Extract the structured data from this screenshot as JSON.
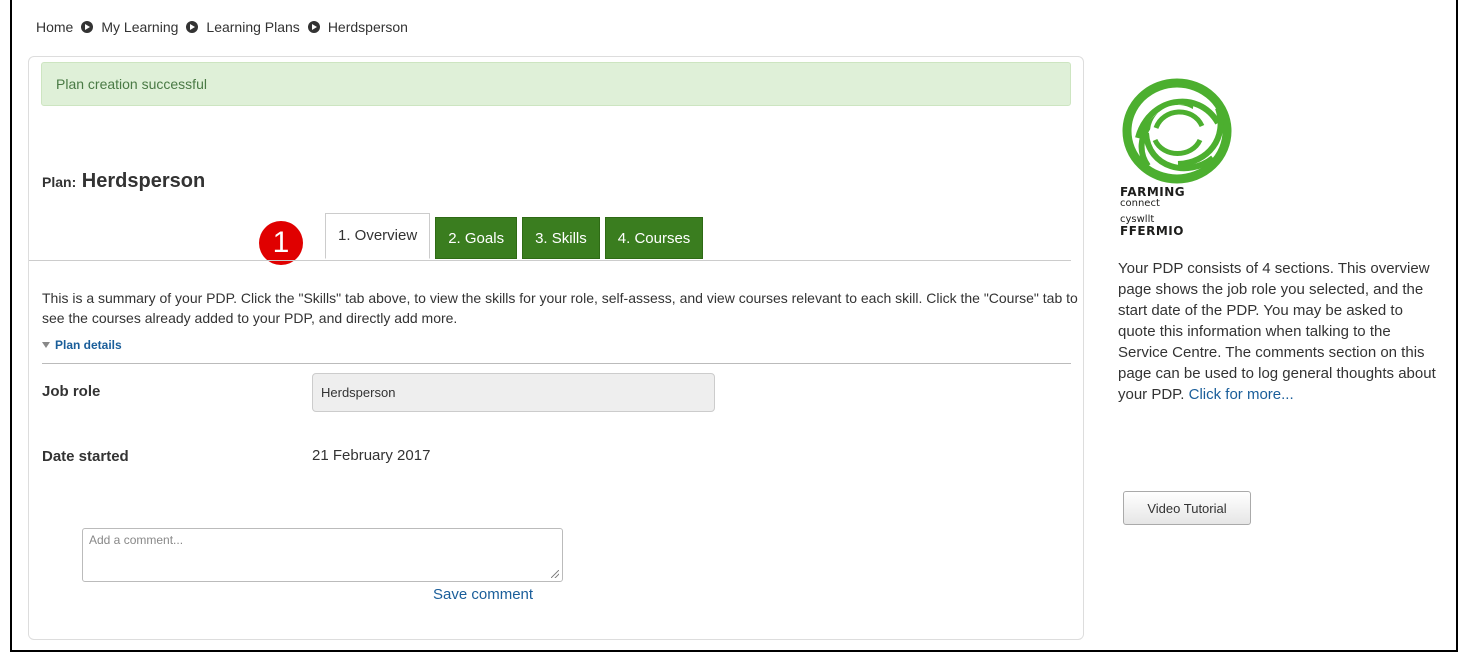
{
  "breadcrumb": {
    "items": [
      "Home",
      "My Learning",
      "Learning Plans"
    ],
    "current": "Herdsperson"
  },
  "alert": {
    "message": "Plan creation successful"
  },
  "plan": {
    "label": "Plan:",
    "name": "Herdsperson"
  },
  "step_badge": "1",
  "tabs": [
    {
      "label": "1. Overview",
      "active": true
    },
    {
      "label": "2. Goals",
      "active": false
    },
    {
      "label": "3. Skills",
      "active": false
    },
    {
      "label": "4. Courses",
      "active": false
    }
  ],
  "summary": "This is a summary of your PDP. Click the \"Skills\" tab above, to view the skills for your role, self-assess, and view courses relevant to each skill. Click the \"Course\" tab to see the courses already added to your PDP, and directly add more.",
  "plan_details_label": "Plan details",
  "fields": {
    "job_role_label": "Job role",
    "job_role_value": "Herdsperson",
    "date_started_label": "Date started",
    "date_started_value": "21 February 2017"
  },
  "comment": {
    "placeholder": "Add a comment...",
    "save_label": "Save comment"
  },
  "sidebar": {
    "logo": {
      "line1": "FARMING",
      "line2": "connect",
      "line3": "cyswllt",
      "line4": "FFERMIO"
    },
    "text": "Your PDP consists of 4 sections. This overview page shows the job role you selected, and the start date of the PDP. You may be asked to quote this information when talking to the Service Centre. The comments section on this page can be used to log general thoughts about your PDP.",
    "more_link": "Click for more...",
    "video_button": "Video Tutorial"
  },
  "colors": {
    "tab_green": "#3a7d1f",
    "alert_bg": "#dff0d8",
    "link": "#1a5e9a",
    "badge": "#e00000",
    "logo_green": "#4caf2f"
  }
}
